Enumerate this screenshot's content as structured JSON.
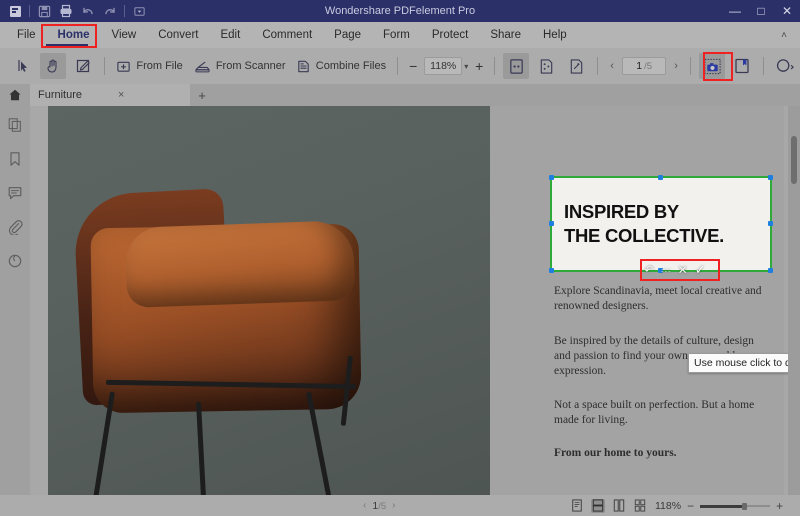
{
  "window": {
    "title": "Wondershare PDFelement Pro",
    "quick_access": [
      {
        "name": "app-logo-icon",
        "glyph": "logo"
      },
      {
        "name": "save-icon",
        "glyph": "save"
      },
      {
        "name": "print-icon",
        "glyph": "print"
      },
      {
        "name": "undo-icon",
        "glyph": "undo"
      },
      {
        "name": "redo-icon",
        "glyph": "redo"
      },
      {
        "name": "customize-quick-access-icon",
        "glyph": "caret-down"
      }
    ],
    "controls": {
      "minimize": "—",
      "maximize": "□",
      "close": "✕"
    }
  },
  "menubar": {
    "items": [
      {
        "label": "File",
        "active": false
      },
      {
        "label": "Home",
        "active": true
      },
      {
        "label": "View",
        "active": false
      },
      {
        "label": "Convert",
        "active": false
      },
      {
        "label": "Edit",
        "active": false
      },
      {
        "label": "Comment",
        "active": false
      },
      {
        "label": "Page",
        "active": false
      },
      {
        "label": "Form",
        "active": false
      },
      {
        "label": "Protect",
        "active": false
      },
      {
        "label": "Share",
        "active": false
      },
      {
        "label": "Help",
        "active": false
      }
    ],
    "collapse_glyph": "˄"
  },
  "toolbar": {
    "select_tool": "select-cursor",
    "hand_tool": "hand",
    "edit_tool": "edit-page",
    "from_file_label": "From File",
    "from_scanner_label": "From Scanner",
    "combine_files_label": "Combine Files",
    "zoom_out": "−",
    "zoom_value": "118%",
    "zoom_in": "+",
    "view_modes": [
      "fit-page",
      "fit-width",
      "single-page"
    ],
    "prev_page": "‹",
    "next_page": "›",
    "page_current": "1",
    "page_total": "/5",
    "snapshot_tool": "snapshot",
    "bookmark_tool": "bookmark",
    "search_tool": "search"
  },
  "tabbar": {
    "home_tab": "home",
    "document_tab": "Furniture",
    "close_tab": "×",
    "new_tab": "+"
  },
  "sidebar": {
    "items": [
      {
        "name": "thumbnails-panel",
        "icon": "pages-icon"
      },
      {
        "name": "bookmarks-panel",
        "icon": "bookmark-icon"
      },
      {
        "name": "comments-panel",
        "icon": "comment-icon"
      },
      {
        "name": "attachments-panel",
        "icon": "paperclip-icon"
      },
      {
        "name": "stamps-panel",
        "icon": "stamp-icon"
      }
    ]
  },
  "document": {
    "headline_line1": "INSPIRED BY",
    "headline_line2": "THE COLLECTIVE.",
    "paragraph1": "Explore Scandinavia, meet local creative and renowned designers.",
    "paragraph2": "Be inspired by the details of culture, design and passion to find your own personal home expression.",
    "paragraph3": "Not a space built on perfection. But a home made for living.",
    "paragraph4": "From our home to yours."
  },
  "object_toolbar": {
    "undo": "↶",
    "save": "⎓",
    "cancel": "✕",
    "confirm": "✓"
  },
  "tooltip": {
    "text": "Use mouse click to drag the"
  },
  "statusbar": {
    "prev_page": "‹",
    "page_current": "1",
    "page_total": "/5",
    "next_page": "›",
    "views": [
      "single-page-view",
      "continuous-view",
      "facing-view",
      "tiled-view"
    ],
    "zoom_value": "118%",
    "zoom_out": "−",
    "zoom_in": "+"
  },
  "annotations": {
    "highlight_color": "#ee2222",
    "selection_color": "#2eaa3a",
    "handle_color": "#1e7fe0",
    "accent_color": "#2b3068"
  }
}
